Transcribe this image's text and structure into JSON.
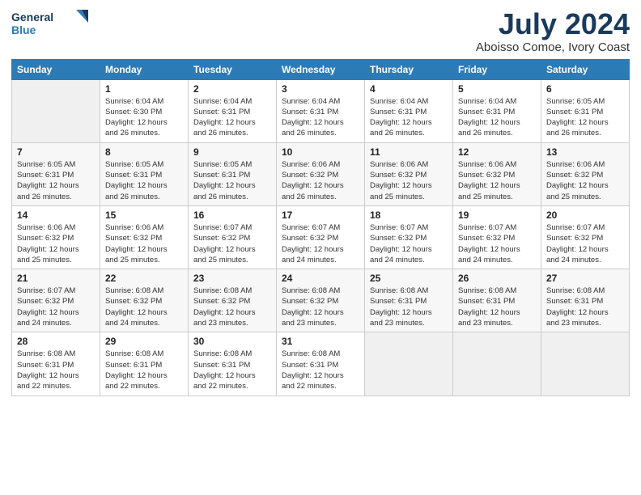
{
  "logo": {
    "line1": "General",
    "line2": "Blue"
  },
  "title": "July 2024",
  "subtitle": "Aboisso Comoe, Ivory Coast",
  "days_header": [
    "Sunday",
    "Monday",
    "Tuesday",
    "Wednesday",
    "Thursday",
    "Friday",
    "Saturday"
  ],
  "weeks": [
    [
      {
        "day": "",
        "info": ""
      },
      {
        "day": "1",
        "info": "Sunrise: 6:04 AM\nSunset: 6:30 PM\nDaylight: 12 hours\nand 26 minutes."
      },
      {
        "day": "2",
        "info": "Sunrise: 6:04 AM\nSunset: 6:31 PM\nDaylight: 12 hours\nand 26 minutes."
      },
      {
        "day": "3",
        "info": "Sunrise: 6:04 AM\nSunset: 6:31 PM\nDaylight: 12 hours\nand 26 minutes."
      },
      {
        "day": "4",
        "info": "Sunrise: 6:04 AM\nSunset: 6:31 PM\nDaylight: 12 hours\nand 26 minutes."
      },
      {
        "day": "5",
        "info": "Sunrise: 6:04 AM\nSunset: 6:31 PM\nDaylight: 12 hours\nand 26 minutes."
      },
      {
        "day": "6",
        "info": "Sunrise: 6:05 AM\nSunset: 6:31 PM\nDaylight: 12 hours\nand 26 minutes."
      }
    ],
    [
      {
        "day": "7",
        "info": "Sunrise: 6:05 AM\nSunset: 6:31 PM\nDaylight: 12 hours\nand 26 minutes."
      },
      {
        "day": "8",
        "info": "Sunrise: 6:05 AM\nSunset: 6:31 PM\nDaylight: 12 hours\nand 26 minutes."
      },
      {
        "day": "9",
        "info": "Sunrise: 6:05 AM\nSunset: 6:31 PM\nDaylight: 12 hours\nand 26 minutes."
      },
      {
        "day": "10",
        "info": "Sunrise: 6:06 AM\nSunset: 6:32 PM\nDaylight: 12 hours\nand 26 minutes."
      },
      {
        "day": "11",
        "info": "Sunrise: 6:06 AM\nSunset: 6:32 PM\nDaylight: 12 hours\nand 25 minutes."
      },
      {
        "day": "12",
        "info": "Sunrise: 6:06 AM\nSunset: 6:32 PM\nDaylight: 12 hours\nand 25 minutes."
      },
      {
        "day": "13",
        "info": "Sunrise: 6:06 AM\nSunset: 6:32 PM\nDaylight: 12 hours\nand 25 minutes."
      }
    ],
    [
      {
        "day": "14",
        "info": "Sunrise: 6:06 AM\nSunset: 6:32 PM\nDaylight: 12 hours\nand 25 minutes."
      },
      {
        "day": "15",
        "info": "Sunrise: 6:06 AM\nSunset: 6:32 PM\nDaylight: 12 hours\nand 25 minutes."
      },
      {
        "day": "16",
        "info": "Sunrise: 6:07 AM\nSunset: 6:32 PM\nDaylight: 12 hours\nand 25 minutes."
      },
      {
        "day": "17",
        "info": "Sunrise: 6:07 AM\nSunset: 6:32 PM\nDaylight: 12 hours\nand 24 minutes."
      },
      {
        "day": "18",
        "info": "Sunrise: 6:07 AM\nSunset: 6:32 PM\nDaylight: 12 hours\nand 24 minutes."
      },
      {
        "day": "19",
        "info": "Sunrise: 6:07 AM\nSunset: 6:32 PM\nDaylight: 12 hours\nand 24 minutes."
      },
      {
        "day": "20",
        "info": "Sunrise: 6:07 AM\nSunset: 6:32 PM\nDaylight: 12 hours\nand 24 minutes."
      }
    ],
    [
      {
        "day": "21",
        "info": "Sunrise: 6:07 AM\nSunset: 6:32 PM\nDaylight: 12 hours\nand 24 minutes."
      },
      {
        "day": "22",
        "info": "Sunrise: 6:08 AM\nSunset: 6:32 PM\nDaylight: 12 hours\nand 24 minutes."
      },
      {
        "day": "23",
        "info": "Sunrise: 6:08 AM\nSunset: 6:32 PM\nDaylight: 12 hours\nand 23 minutes."
      },
      {
        "day": "24",
        "info": "Sunrise: 6:08 AM\nSunset: 6:32 PM\nDaylight: 12 hours\nand 23 minutes."
      },
      {
        "day": "25",
        "info": "Sunrise: 6:08 AM\nSunset: 6:31 PM\nDaylight: 12 hours\nand 23 minutes."
      },
      {
        "day": "26",
        "info": "Sunrise: 6:08 AM\nSunset: 6:31 PM\nDaylight: 12 hours\nand 23 minutes."
      },
      {
        "day": "27",
        "info": "Sunrise: 6:08 AM\nSunset: 6:31 PM\nDaylight: 12 hours\nand 23 minutes."
      }
    ],
    [
      {
        "day": "28",
        "info": "Sunrise: 6:08 AM\nSunset: 6:31 PM\nDaylight: 12 hours\nand 22 minutes."
      },
      {
        "day": "29",
        "info": "Sunrise: 6:08 AM\nSunset: 6:31 PM\nDaylight: 12 hours\nand 22 minutes."
      },
      {
        "day": "30",
        "info": "Sunrise: 6:08 AM\nSunset: 6:31 PM\nDaylight: 12 hours\nand 22 minutes."
      },
      {
        "day": "31",
        "info": "Sunrise: 6:08 AM\nSunset: 6:31 PM\nDaylight: 12 hours\nand 22 minutes."
      },
      {
        "day": "",
        "info": ""
      },
      {
        "day": "",
        "info": ""
      },
      {
        "day": "",
        "info": ""
      }
    ]
  ]
}
